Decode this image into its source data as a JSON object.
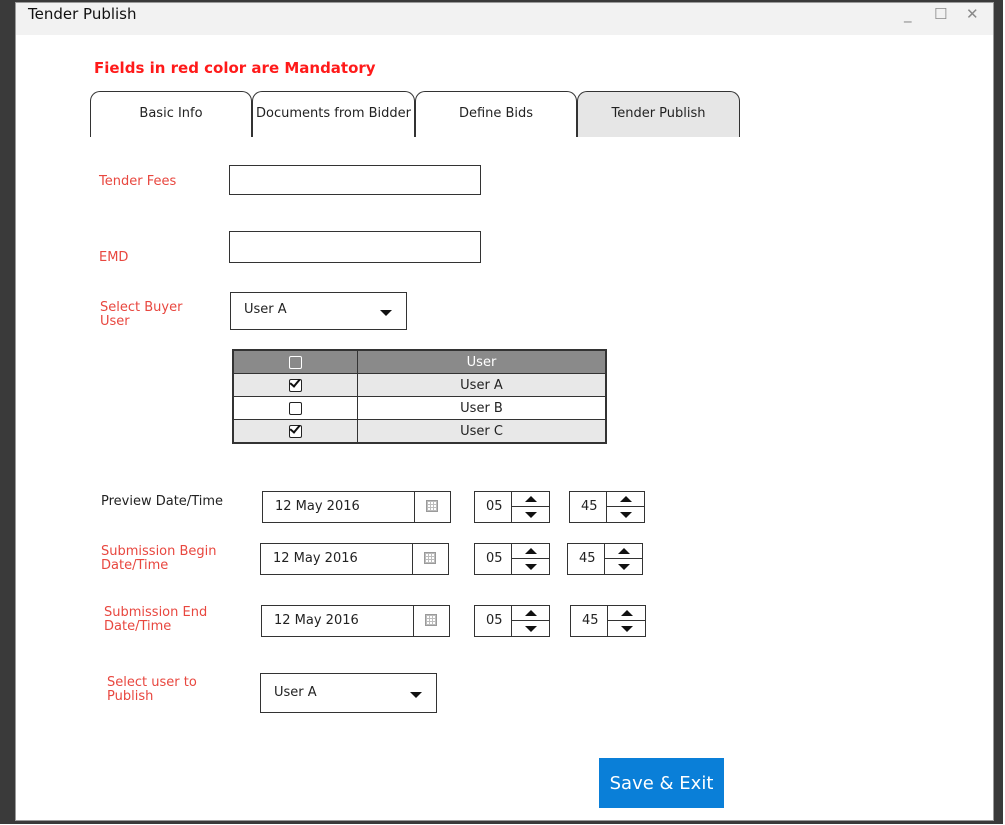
{
  "window": {
    "title": "Tender Publish",
    "controls": {
      "minimize": "_",
      "maximize": "☐",
      "close": "✕"
    }
  },
  "notice": "Fields in red color are Mandatory",
  "tabs": [
    {
      "label": "Basic Info",
      "active": false
    },
    {
      "label": "Documents from Bidder",
      "active": false
    },
    {
      "label": "Define Bids",
      "active": false
    },
    {
      "label": "Tender Publish",
      "active": true
    }
  ],
  "form": {
    "tender_fees": {
      "label": "Tender Fees",
      "value": ""
    },
    "emd": {
      "label": "EMD",
      "value": ""
    },
    "buyer_user": {
      "label": "Select Buyer User",
      "value": "User A"
    },
    "user_table": {
      "headers": [
        "",
        "User"
      ],
      "rows": [
        {
          "checked": true,
          "user": "User A"
        },
        {
          "checked": false,
          "user": "User B"
        },
        {
          "checked": true,
          "user": "User C"
        }
      ]
    },
    "preview": {
      "label": "Preview Date/Time",
      "date": "12 May 2016",
      "hour": "05",
      "minute": "45"
    },
    "submission_begin": {
      "label": "Submission Begin Date/Time",
      "date": "12 May 2016",
      "hour": "05",
      "minute": "45"
    },
    "submission_end": {
      "label": "Submission End Date/Time",
      "date": "12 May 2016",
      "hour": "05",
      "minute": "45"
    },
    "publish_user": {
      "label": "Select user to Publish",
      "value": "User A"
    }
  },
  "actions": {
    "save_exit": "Save & Exit"
  },
  "colors": {
    "mandatory": "#ff1a1a",
    "label_red": "#e8473f",
    "primary_button": "#0a7fd8",
    "table_header": "#8a8a8a"
  }
}
